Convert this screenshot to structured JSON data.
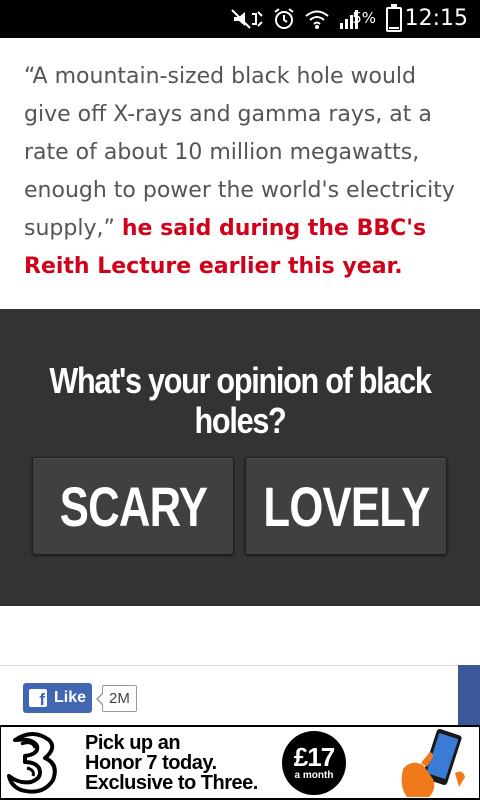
{
  "status_bar": {
    "battery_percent": "5%",
    "time": "12:15",
    "icons": [
      "mute-icon",
      "alarm-icon",
      "wifi-icon",
      "signal-icon",
      "battery-icon"
    ]
  },
  "article": {
    "quote": "“A mountain-sized black hole would give off X-rays and gamma rays, at a rate of about 10 million megawatts, enough to power the world's electricity supply,”",
    "attribution": "he said during the BBC's Reith Lecture earlier this year."
  },
  "poll": {
    "question": "What's your opinion of black holes?",
    "options": [
      "SCARY",
      "LOVELY"
    ]
  },
  "share": {
    "like_label": "Like",
    "like_count": "2M"
  },
  "ad": {
    "line1": "Pick up an",
    "line2": "Honor 7 today.",
    "line3": "Exclusive to Three.",
    "price": "£17",
    "price_period": "a month"
  },
  "colors": {
    "highlight_red": "#d0021b",
    "poll_background": "#333333",
    "facebook_blue": "#4267b2"
  }
}
